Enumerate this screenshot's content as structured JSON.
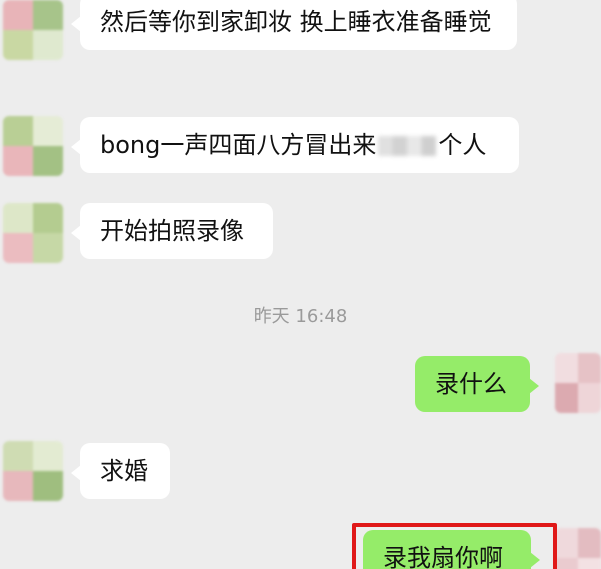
{
  "conversation": {
    "timestamp": "昨天 16:48",
    "messages": [
      {
        "side": "in",
        "text": "然后等你到家卸妆 换上睡衣准备睡觉"
      },
      {
        "side": "in",
        "text_before": "bong一声四面八方冒出来",
        "text_after": "个人"
      },
      {
        "side": "in",
        "text": "开始拍照录像"
      },
      {
        "side": "out",
        "text": "录什么"
      },
      {
        "side": "in",
        "text": "求婚"
      },
      {
        "side": "out",
        "text": "录我扇你啊"
      }
    ]
  },
  "colors": {
    "background": "#ededed",
    "incoming_bubble": "#ffffff",
    "outgoing_bubble": "#95ec69",
    "highlight_border": "#e01818",
    "timestamp_text": "#9a9a9a"
  }
}
